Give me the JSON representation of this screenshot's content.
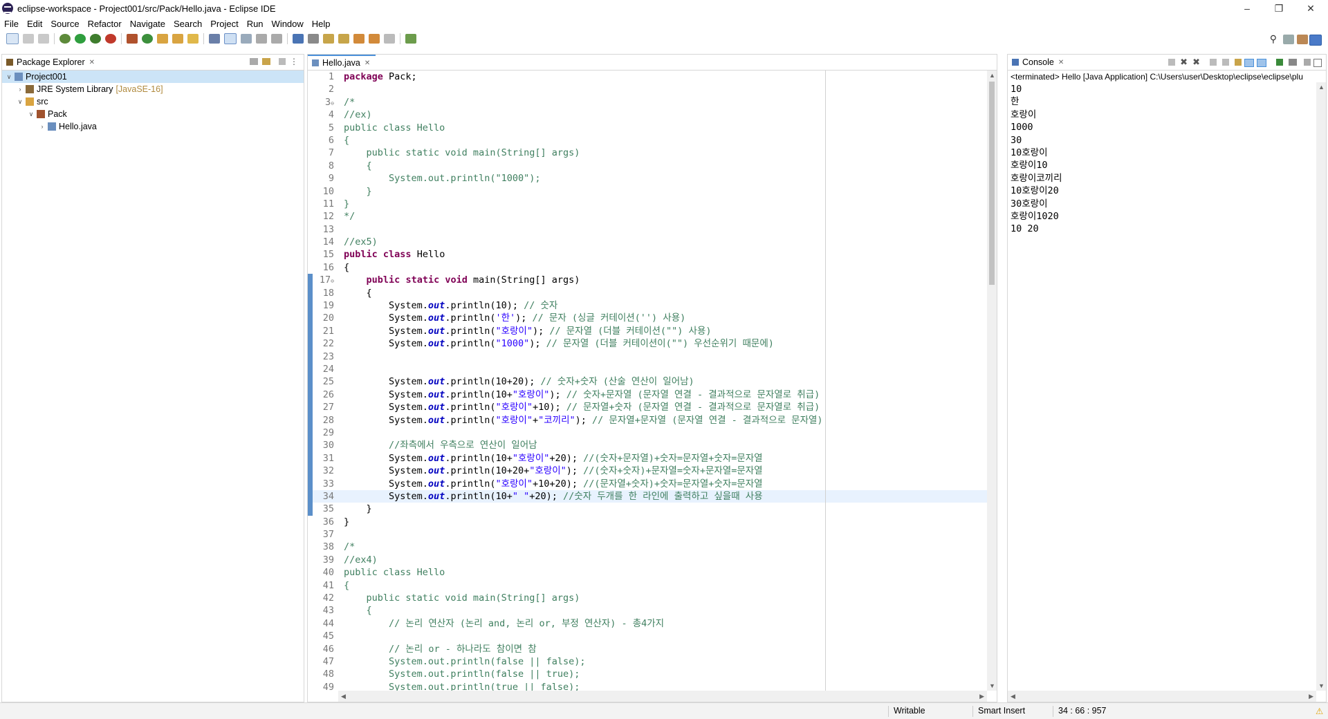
{
  "window": {
    "title": "eclipse-workspace - Project001/src/Pack/Hello.java - Eclipse IDE"
  },
  "menu": [
    "File",
    "Edit",
    "Source",
    "Refactor",
    "Navigate",
    "Search",
    "Project",
    "Run",
    "Window",
    "Help"
  ],
  "package_explorer": {
    "tab_label": "Package Explorer",
    "tree": [
      {
        "label": "Project001",
        "level": 0,
        "twisty": "expanded",
        "icon": "project-icon",
        "selected": true
      },
      {
        "label": "JRE System Library",
        "decoration": "[JavaSE-16]",
        "level": 1,
        "twisty": "collapsed",
        "icon": "library-icon"
      },
      {
        "label": "src",
        "level": 1,
        "twisty": "expanded",
        "icon": "source-folder-icon"
      },
      {
        "label": "Pack",
        "level": 2,
        "twisty": "expanded",
        "icon": "package-icon"
      },
      {
        "label": "Hello.java",
        "level": 3,
        "twisty": "collapsed",
        "icon": "java-file-icon"
      }
    ]
  },
  "editor": {
    "tab_label": "Hello.java",
    "lines": [
      "package Pack;",
      "",
      "/*",
      "//ex)",
      "public class Hello",
      "{",
      "    public static void main(String[] args)",
      "    {",
      "        System.out.println(\"1000\");",
      "    }",
      "}",
      "*/",
      "",
      "//ex5)",
      "public class Hello",
      "{",
      "    public static void main(String[] args)",
      "    {",
      "        System.out.println(10); // 숫자",
      "        System.out.println('한'); // 문자 (싱글 커테이션('') 사용)",
      "        System.out.println(\"호랑이\"); // 문자열 (더블 커테이션(\"\") 사용)",
      "        System.out.println(\"1000\"); // 문자열 (더블 커테이션이(\"\") 우선순위기 때문에)",
      "",
      "",
      "        System.out.println(10+20); // 숫자+숫자 (산술 연산이 일어남)",
      "        System.out.println(10+\"호랑이\"); // 숫자+문자열 (문자열 연결 - 결과적으로 문자열로 취급)",
      "        System.out.println(\"호랑이\"+10); // 문자열+숫자 (문자열 연결 - 결과적으로 문자열로 취급)",
      "        System.out.println(\"호랑이\"+\"코끼리\"); // 문자열+문자열 (문자열 연결 - 결과적으로 문자열)",
      "",
      "        //좌측에서 우측으로 연산이 일어남",
      "        System.out.println(10+\"호랑이\"+20); //(숫자+문자열)+숫자=문자열+숫자=문자열",
      "        System.out.println(10+20+\"호랑이\"); //(숫자+숫자)+문자열=숫자+문자열=문자열",
      "        System.out.println(\"호랑이\"+10+20); //(문자열+숫자)+숫자=문자열+숫자=문자열",
      "        System.out.println(10+\" \"+20); //숫자 두개를 한 라인에 출력하고 싶을때 사용",
      "    }",
      "}",
      "",
      "/*",
      "//ex4)",
      "public class Hello",
      "{",
      "    public static void main(String[] args)",
      "    {",
      "        // 논리 연산자 (논리 and, 논리 or, 부정 연산자) - 총4가지",
      "",
      "        // 논리 or - 하나라도 참이면 참",
      "        System.out.println(false || false);",
      "        System.out.println(false || true);",
      "        System.out.println(true || false);"
    ],
    "fold_markers": [
      3,
      17
    ],
    "current_line": 34
  },
  "console": {
    "tab_label": "Console",
    "header": "<terminated> Hello [Java Application] C:\\Users\\user\\Desktop\\eclipse\\eclipse\\plu",
    "output": [
      "10",
      "한",
      "호랑이",
      "1000",
      "30",
      "10호랑이",
      "호랑이10",
      "호랑이코끼리",
      "10호랑이20",
      "30호랑이",
      "호랑이1020",
      "10 20"
    ]
  },
  "status": {
    "writable": "Writable",
    "insert_mode": "Smart Insert",
    "position": "34 : 66 : 957"
  },
  "colors": {
    "keyword": "#7f0055",
    "comment": "#3f7f5f",
    "string": "#2a00ff",
    "field": "#0000c0",
    "current_line": "#e8f2fe",
    "selection": "#cce4f7"
  }
}
